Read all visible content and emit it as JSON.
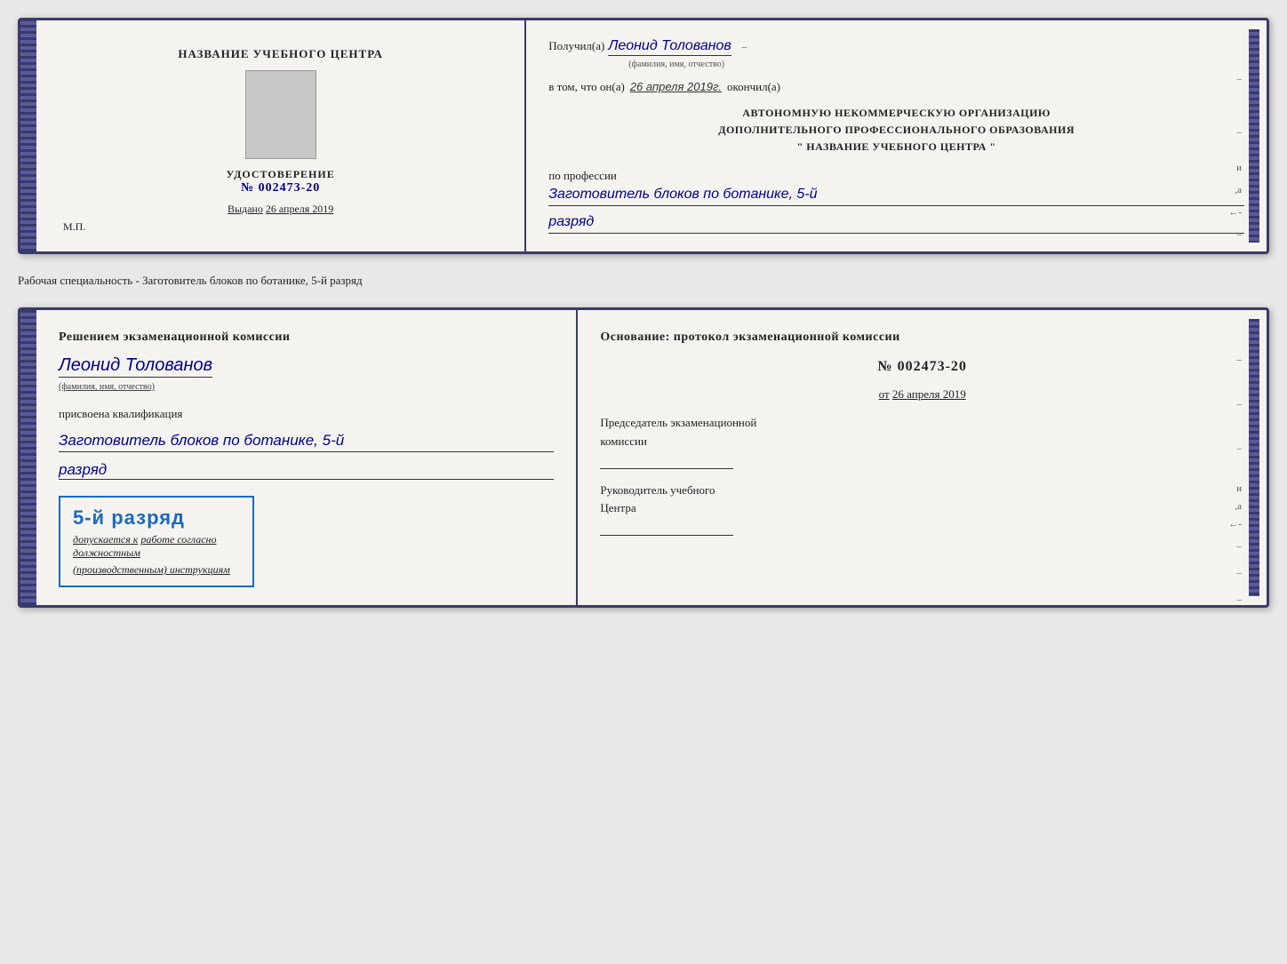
{
  "doc1": {
    "left": {
      "title": "НАЗВАНИЕ УЧЕБНОГО ЦЕНТРА",
      "cert_label": "УДОСТОВЕРЕНИЕ",
      "cert_number_prefix": "№",
      "cert_number": "002473-20",
      "issued_prefix": "Выдано",
      "issued_date": "26 апреля 2019",
      "mp": "М.П."
    },
    "right": {
      "received_prefix": "Получил(а)",
      "recipient_name": "Леонид Толованов",
      "fio_caption": "(фамилия, имя, отчество)",
      "confirm_prefix": "в том, что он(а)",
      "confirm_date": "26 апреля 2019г.",
      "confirm_suffix": "окончил(а)",
      "org_line1": "АВТОНОМНУЮ НЕКОММЕРЧЕСКУЮ ОРГАНИЗАЦИЮ",
      "org_line2": "ДОПОЛНИТЕЛЬНОГО ПРОФЕССИОНАЛЬНОГО ОБРАЗОВАНИЯ",
      "org_line3": "\"   НАЗВАНИЕ УЧЕБНОГО ЦЕНТРА   \"",
      "profession_label": "по профессии",
      "profession_value": "Заготовитель блоков по ботанике, 5-й",
      "rank_value": "разряд"
    }
  },
  "specialty_caption": "Рабочая специальность - Заготовитель блоков по ботанике, 5-й разряд",
  "doc2": {
    "left": {
      "commission_text": "Решением экзаменационной комиссии",
      "person_name": "Леонид Толованов",
      "fio_caption": "(фамилия, имя, отчество)",
      "qualification_label": "присвоена квалификация",
      "qualification_value": "Заготовитель блоков по ботанике, 5-й",
      "rank_value": "разряд",
      "stamp_rank": "5-й разряд",
      "stamp_sub1": "допускается к",
      "stamp_sub2": "работе согласно должностным",
      "stamp_sub3": "(производственным) инструкциям"
    },
    "right": {
      "basis_text": "Основание: протокол экзаменационной комиссии",
      "protocol_prefix": "№",
      "protocol_number": "002473-20",
      "date_prefix": "от",
      "date_value": "26 апреля 2019",
      "chairman_label": "Председатель экзаменационной",
      "chairman_label2": "комиссии",
      "director_label": "Руководитель учебного",
      "director_label2": "Центра"
    }
  }
}
